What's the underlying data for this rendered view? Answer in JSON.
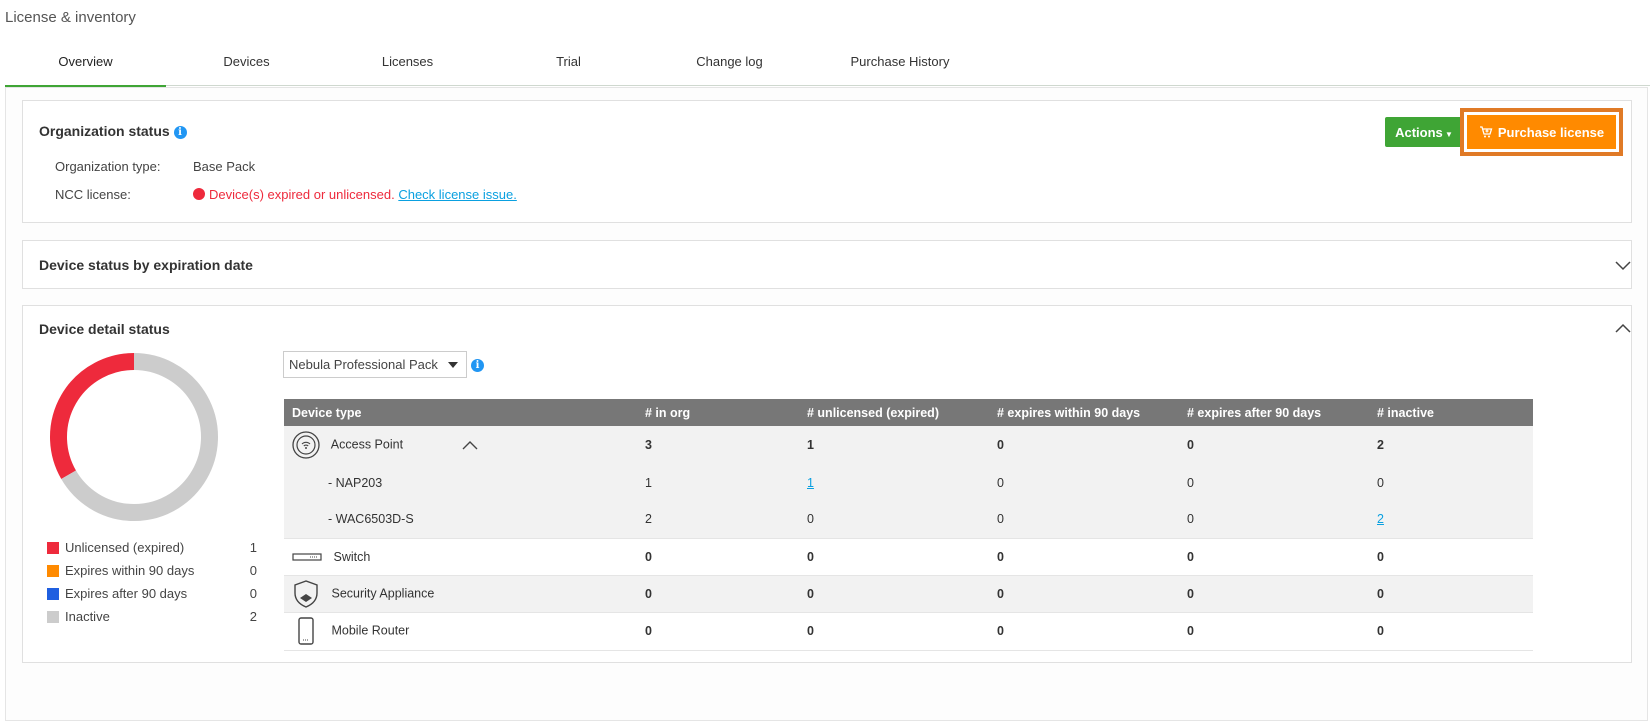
{
  "page": {
    "title": "License & inventory"
  },
  "tabs": [
    {
      "label": "Overview",
      "active": true
    },
    {
      "label": "Devices",
      "active": false
    },
    {
      "label": "Licenses",
      "active": false
    },
    {
      "label": "Trial",
      "active": false
    },
    {
      "label": "Change log",
      "active": false
    },
    {
      "label": "Purchase History",
      "active": false
    }
  ],
  "org_status": {
    "title": "Organization status",
    "type_label": "Organization type:",
    "type_value": "Base Pack",
    "ncc_label": "NCC license:",
    "ncc_error": "Device(s) expired or unlicensed.",
    "ncc_link": "Check license issue.",
    "actions_label": "Actions",
    "purchase_label": "Purchase license"
  },
  "expiration_panel": {
    "title": "Device status by expiration date"
  },
  "detail_panel": {
    "title": "Device detail status",
    "pack_select": "Nebula Professional Pack",
    "legend": [
      {
        "label": "Unlicensed (expired)",
        "count": "1",
        "color": "#ee2a3c"
      },
      {
        "label": "Expires within 90 days",
        "count": "0",
        "color": "#ff8a00"
      },
      {
        "label": "Expires after 90 days",
        "count": "0",
        "color": "#1f5fe0"
      },
      {
        "label": "Inactive",
        "count": "2",
        "color": "#cccccc"
      }
    ],
    "table": {
      "headers": [
        "Device type",
        "# in org",
        "# unlicensed (expired)",
        "# expires within 90 days",
        "# expires after 90 days",
        "# inactive"
      ],
      "rows": [
        {
          "device": "Access Point",
          "in_org": "3",
          "unlicensed": "1",
          "within90": "0",
          "after90": "0",
          "inactive": "2"
        },
        {
          "device": "- NAP203",
          "in_org": "1",
          "unlicensed": "1",
          "within90": "0",
          "after90": "0",
          "inactive": "0"
        },
        {
          "device": "- WAC6503D-S",
          "in_org": "2",
          "unlicensed": "0",
          "within90": "0",
          "after90": "0",
          "inactive": "2"
        },
        {
          "device": "Switch",
          "in_org": "0",
          "unlicensed": "0",
          "within90": "0",
          "after90": "0",
          "inactive": "0"
        },
        {
          "device": "Security Appliance",
          "in_org": "0",
          "unlicensed": "0",
          "within90": "0",
          "after90": "0",
          "inactive": "0"
        },
        {
          "device": "Mobile Router",
          "in_org": "0",
          "unlicensed": "0",
          "within90": "0",
          "after90": "0",
          "inactive": "0"
        }
      ]
    }
  },
  "chart_data": {
    "type": "pie",
    "categories": [
      "Unlicensed (expired)",
      "Expires within 90 days",
      "Expires after 90 days",
      "Inactive"
    ],
    "values": [
      1,
      0,
      0,
      2
    ],
    "colors": [
      "#ee2a3c",
      "#ff8a00",
      "#1f5fe0",
      "#cccccc"
    ],
    "legend": "bottom"
  }
}
